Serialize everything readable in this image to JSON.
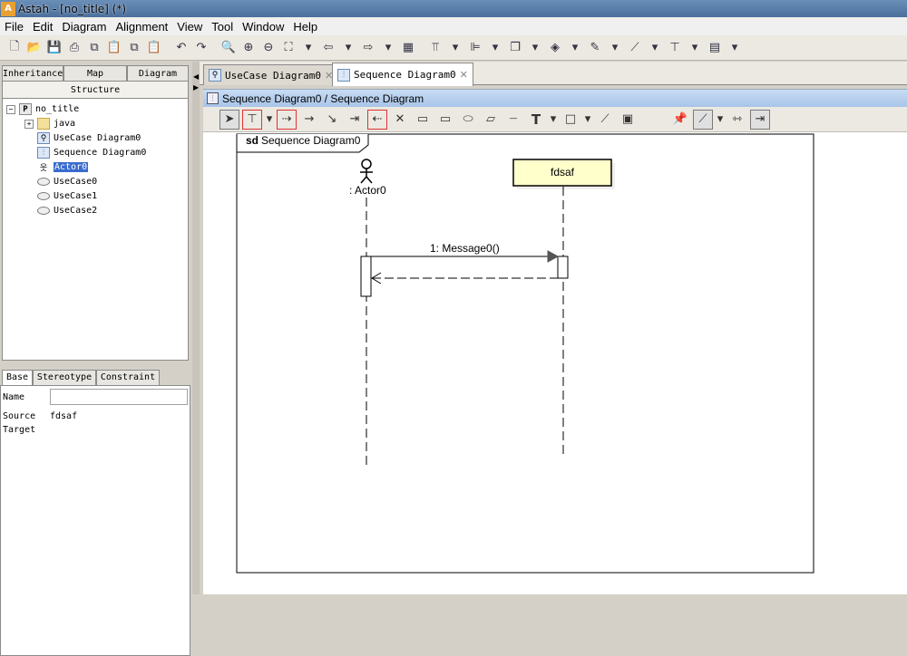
{
  "window": {
    "title": "Astah - [no_title] (*)",
    "app_icon": "A"
  },
  "menu": [
    "File",
    "Edit",
    "Diagram",
    "Alignment",
    "View",
    "Tool",
    "Window",
    "Help"
  ],
  "left_tabs": {
    "inheritance": "Inheritance",
    "map": "Map",
    "diagram": "Diagram",
    "structure": "Structure"
  },
  "tree": {
    "root": "no_title",
    "java": "java",
    "usecase_diagram": "UseCase Diagram0",
    "sequence_diagram": "Sequence Diagram0",
    "actor": "Actor0",
    "usecase0": "UseCase0",
    "usecase1": "UseCase1",
    "usecase2": "UseCase2"
  },
  "prop_tabs": {
    "base": "Base",
    "stereotype": "Stereotype",
    "constraint": "Constraint"
  },
  "props": {
    "name_label": "Name",
    "name_value": "",
    "source_label": "Source",
    "source_value": "fdsaf",
    "target_label": "Target"
  },
  "doc_tabs": {
    "usecase": "UseCase Diagram0",
    "sequence": "Sequence Diagram0"
  },
  "breadcrumb": "Sequence Diagram0 / Sequence Diagram",
  "diagram": {
    "frame_keyword": "sd",
    "frame_name": "Sequence Diagram0",
    "actor_label": ": Actor0",
    "lifeline_label": "fdsaf",
    "message_label": "1: Message0()"
  },
  "colors": {
    "lifeline_fill": "#ffffcc",
    "selection": "#3a6ccf",
    "header_blue": "#a8c4e8"
  }
}
